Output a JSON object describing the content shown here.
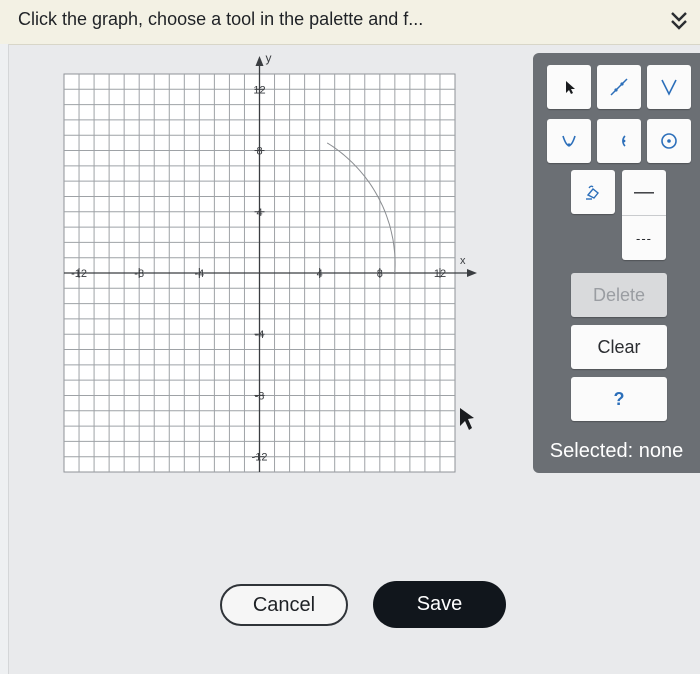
{
  "header": {
    "instruction": "Click the graph, choose a tool in the palette and f..."
  },
  "graph": {
    "x_axis_label": "x",
    "y_axis_label": "y",
    "x_range": [
      -13,
      13
    ],
    "y_range": [
      -13,
      13
    ],
    "x_tick_labels": [
      {
        "value": -12,
        "label": "-12"
      },
      {
        "value": -8,
        "label": "-8"
      },
      {
        "value": -4,
        "label": "-4"
      },
      {
        "value": 4,
        "label": "4"
      },
      {
        "value": 8,
        "label": "8"
      },
      {
        "value": 12,
        "label": "12"
      }
    ],
    "y_tick_labels": [
      {
        "value": 12,
        "label": "12"
      },
      {
        "value": 8,
        "label": "8"
      },
      {
        "value": 4,
        "label": "4"
      },
      {
        "value": -4,
        "label": "-4"
      },
      {
        "value": -8,
        "label": "-8"
      },
      {
        "value": -12,
        "label": "-12"
      }
    ],
    "drawn_curve": {
      "type": "quarter-circle",
      "center": [
        0,
        0
      ],
      "start": [
        4.5,
        8.5
      ],
      "end": [
        9,
        0
      ],
      "color": "#8a8d91"
    }
  },
  "palette": {
    "tools": [
      {
        "name": "pointer-tool",
        "icon": "pointer-icon"
      },
      {
        "name": "line-tool",
        "icon": "line-icon"
      },
      {
        "name": "absolute-value-tool",
        "icon": "v-shape-icon"
      },
      {
        "name": "parabola-tool",
        "icon": "parabola-icon"
      },
      {
        "name": "semicircle-tool",
        "icon": "semicircle-icon"
      },
      {
        "name": "circle-tool",
        "icon": "circle-dot-icon"
      },
      {
        "name": "eraser-tool",
        "icon": "eraser-icon"
      }
    ],
    "solid_line_label": "—",
    "dashed_line_label": "---",
    "delete_label": "Delete",
    "clear_label": "Clear",
    "help_label": "?",
    "selected_label": "Selected: none"
  },
  "footer": {
    "cancel_label": "Cancel",
    "save_label": "Save"
  },
  "colors": {
    "header_bg": "#f3f1e4",
    "palette_bg": "#6b6f74",
    "grid_line": "#9ea2a6",
    "axis": "#3a3d41",
    "help_accent": "#2c6fba",
    "save_bg": "#11161c"
  }
}
